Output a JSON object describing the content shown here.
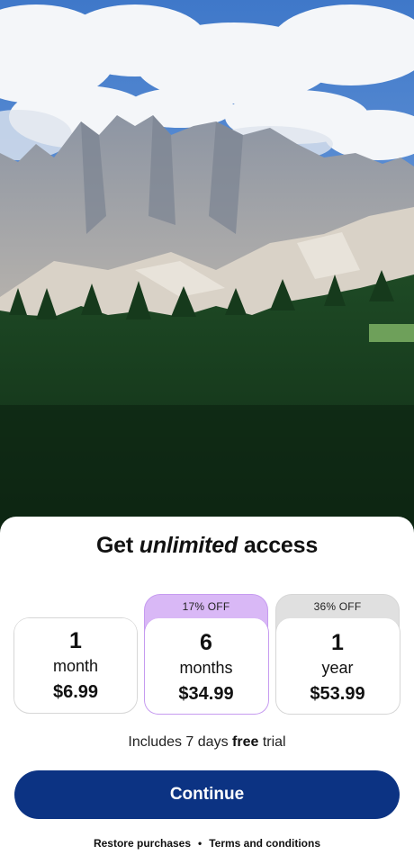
{
  "hero": {
    "image_description_icon": "mountain-landscape-photo"
  },
  "headline": {
    "prefix": "Get ",
    "emphasis": "unlimited",
    "suffix": " access"
  },
  "plans": [
    {
      "badge": "",
      "qty": "1",
      "unit": "month",
      "price": "$6.99",
      "selected": false
    },
    {
      "badge": "17% OFF",
      "qty": "6",
      "unit": "months",
      "price": "$34.99",
      "selected": true
    },
    {
      "badge": "36% OFF",
      "qty": "1",
      "unit": "year",
      "price": "$53.99",
      "selected": false
    }
  ],
  "trial": {
    "prefix": "Includes 7 days ",
    "bold": "free",
    "suffix": " trial"
  },
  "continue_label": "Continue",
  "footer": {
    "restore": "Restore purchases",
    "separator": "•",
    "terms": "Terms and conditions"
  },
  "colors": {
    "primary": "#0c3383",
    "selected_badge": "#d9b8f6",
    "badge_gray": "#e0e0e0"
  }
}
